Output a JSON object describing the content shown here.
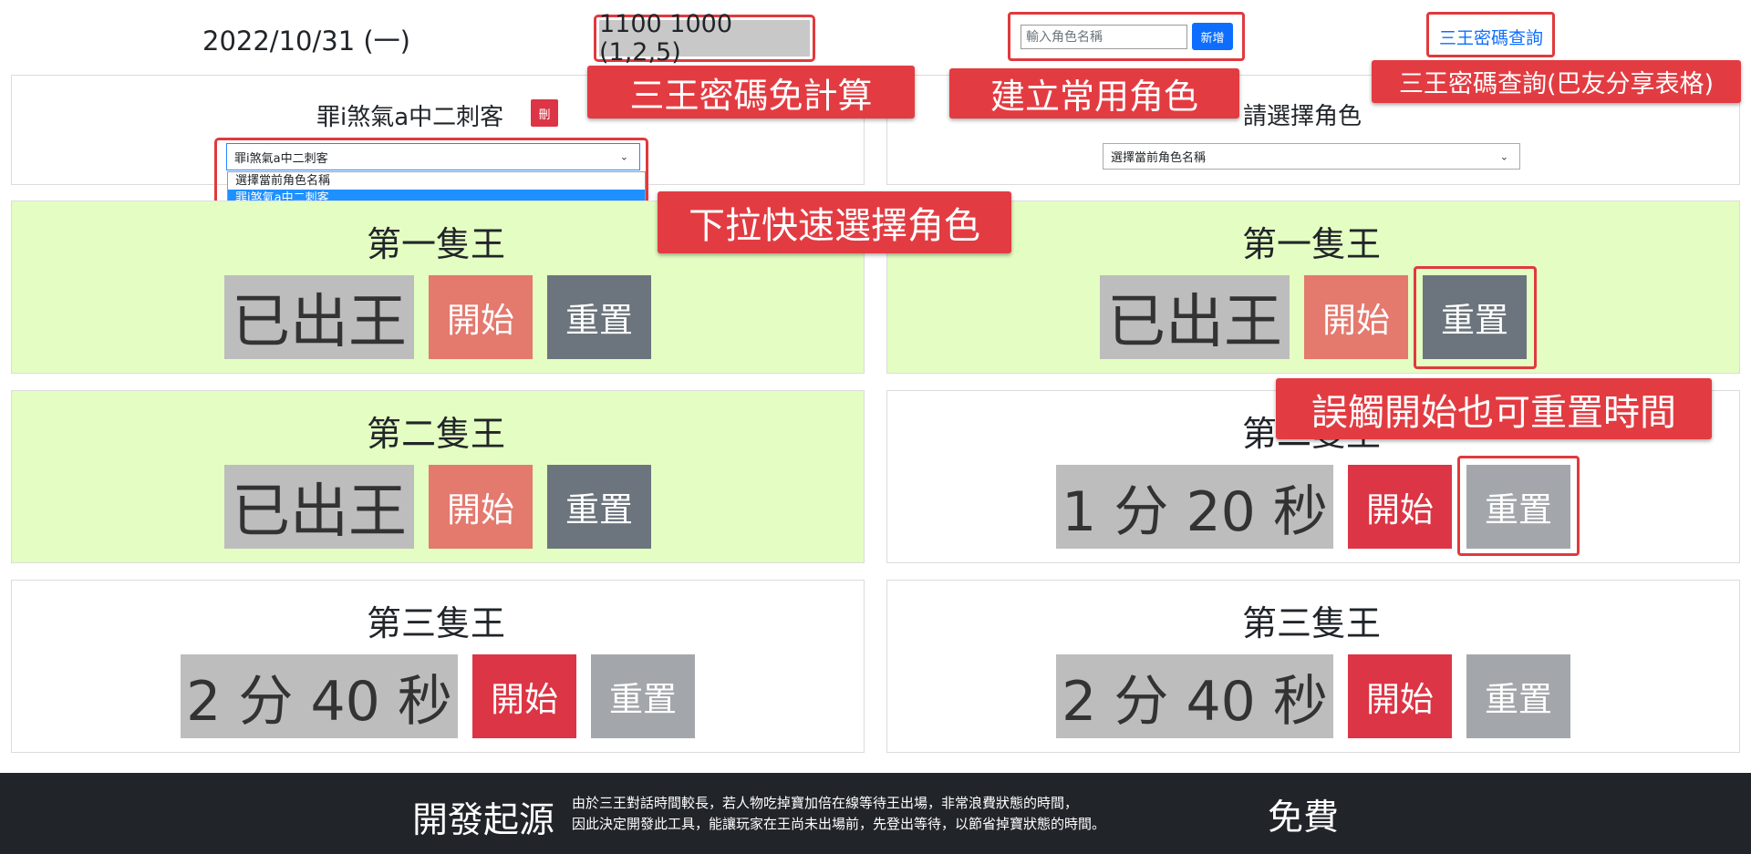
{
  "header": {
    "date": "2022/10/31 (一)",
    "code": "1100 1000 (1,2,5)",
    "char_input_placeholder": "輸入角色名稱",
    "add_button": "新增",
    "query_link": "三王密碼查詢"
  },
  "callouts": {
    "free_calc": "三王密碼免計算",
    "create_role": "建立常用角色",
    "query_table": "三王密碼查詢(巴友分享表格)",
    "dropdown_select": "下拉快速選擇角色",
    "mistouch_reset": "誤觸開始也可重置時間"
  },
  "left": {
    "character_name": "罪i煞氣a中二刺客",
    "delete_button": "刪",
    "select_value": "罪i煞氣a中二刺客",
    "select_options": [
      "選擇當前角色名稱",
      "罪i煞氣a中二刺客"
    ],
    "bosses": [
      {
        "title": "第一隻王",
        "time": "已出王",
        "start": "開始",
        "reset": "重置"
      },
      {
        "title": "第二隻王",
        "time": "已出王",
        "start": "開始",
        "reset": "重置"
      },
      {
        "title": "第三隻王",
        "time": "2 分 40 秒",
        "start": "開始",
        "reset": "重置"
      }
    ]
  },
  "right": {
    "pick_label": "請選擇角色",
    "select_value": "選擇當前角色名稱",
    "bosses": [
      {
        "title": "第一隻王",
        "time": "已出王",
        "start": "開始",
        "reset": "重置"
      },
      {
        "title": "第二隻王",
        "time": "1 分 20 秒",
        "start": "開始",
        "reset": "重置"
      },
      {
        "title": "第三隻王",
        "time": "2 分 40 秒",
        "start": "開始",
        "reset": "重置"
      }
    ]
  },
  "footer": {
    "title": "開發起源",
    "line1": "由於三王對話時間較長，若人物吃掉寶加倍在線等待王出場，非常浪費狀態的時間，",
    "line2": "因此決定開發此工具，能讓玩家在王尚未出場前，先登出等待，以節省掉寶狀態的時間。",
    "free": "免費"
  },
  "colors": {
    "accent_red": "#dc3545",
    "annotation_red": "#e23c42",
    "link_blue": "#0d6efd",
    "boss_done_green": "#e4fdc3",
    "footer_bg": "#212529"
  },
  "icons": {
    "select_arrow": "chevron-down-icon"
  }
}
